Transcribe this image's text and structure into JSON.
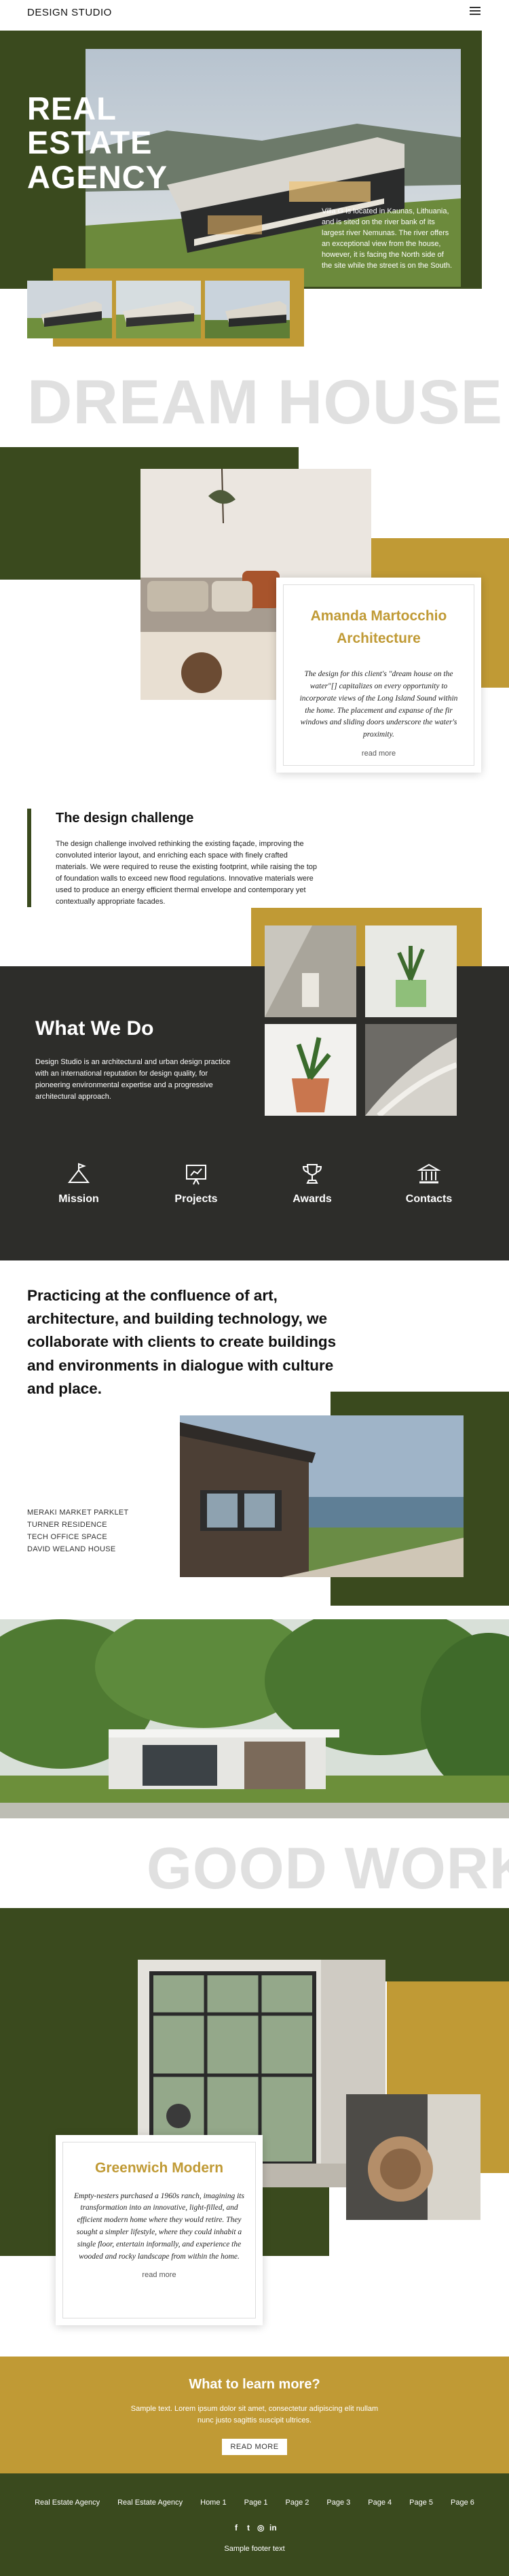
{
  "header": {
    "logo": "DESIGN STUDIO",
    "menu_icon": "hamburger-icon"
  },
  "hero": {
    "title_lines": [
      "REAL",
      "ESTATE",
      "AGENCY"
    ],
    "description": "Villa G is located in Kaunas, Lithuania, and is sited on the river bank of its largest river Nemunas. The river offers an exceptional view from the house, however, it is facing the North side of the site while the street is on the South."
  },
  "dream": {
    "big_word": "DREAM HOUSE",
    "card": {
      "title_lines": [
        "Amanda Martocchio",
        "Architecture"
      ],
      "text": "The design for this client's \"dream house on the water\"[] capitalizes on every opportunity to incorporate views of the Long Island Sound within the home. The placement and expanse of the fir windows and sliding doors underscore the water's proximity.",
      "link": "read more"
    }
  },
  "challenge": {
    "title": "The design challenge",
    "text": "The design challenge involved rethinking the existing façade, improving the convoluted interior layout, and enriching each space with finely crafted materials. We were required to reuse the existing footprint, while raising the top of foundation walls to exceed new flood regulations. Innovative materials were used to produce an energy efficient thermal envelope and contemporary yet contextually appropriate facades."
  },
  "what_we_do": {
    "title": "What We Do",
    "text": "Design Studio is an architectural and urban design practice with an international reputation for design quality, for pioneering environmental expertise and a progressive architectural approach.",
    "services": [
      {
        "label": "Mission",
        "icon": "mountain-flag-icon"
      },
      {
        "label": "Projects",
        "icon": "presentation-board-icon"
      },
      {
        "label": "Awards",
        "icon": "trophy-icon"
      },
      {
        "label": "Contacts",
        "icon": "bank-building-icon"
      }
    ]
  },
  "practice": {
    "text": "Practicing at the confluence of art, architecture, and building technology, we collaborate with clients to create buildings and environments in dialogue with culture and place.",
    "projects": [
      "MERAKI MARKET PARKLET",
      "TURNER RESIDENCE",
      "TECH OFFICE SPACE",
      "DAVID WELAND HOUSE"
    ]
  },
  "good_work": {
    "big_word": "GOOD WORK",
    "card": {
      "title": "Greenwich Modern",
      "text": "Empty-nesters purchased a 1960s ranch, imagining its transformation into an innovative, light-filled, and efficient modern home where they would retire. They sought a simpler lifestyle, where they could inhabit a single floor, entertain informally, and experience the wooded and rocky landscape from within the home.",
      "link": "read more"
    }
  },
  "learn_more": {
    "title": "What to learn more?",
    "text": "Sample text. Lorem ipsum dolor sit amet, consectetur adipiscing elit nullam nunc justo sagittis suscipit ultrices.",
    "button": "READ MORE"
  },
  "footer": {
    "nav": [
      "Real Estate Agency",
      "Real Estate Agency",
      "Home 1",
      "Page 1",
      "Page 2",
      "Page 3",
      "Page 4",
      "Page 5",
      "Page 6"
    ],
    "socials": [
      {
        "glyph": "f",
        "icon": "facebook-icon"
      },
      {
        "glyph": "t",
        "icon": "twitter-icon"
      },
      {
        "glyph": "◎",
        "icon": "instagram-icon"
      },
      {
        "glyph": "in",
        "icon": "linkedin-icon"
      }
    ],
    "text": "Sample footer text"
  },
  "colors": {
    "olive": "#3a4a1e",
    "gold": "#c09a35",
    "charcoal": "#2d2d2a",
    "big_word": "#e0e0e0"
  }
}
